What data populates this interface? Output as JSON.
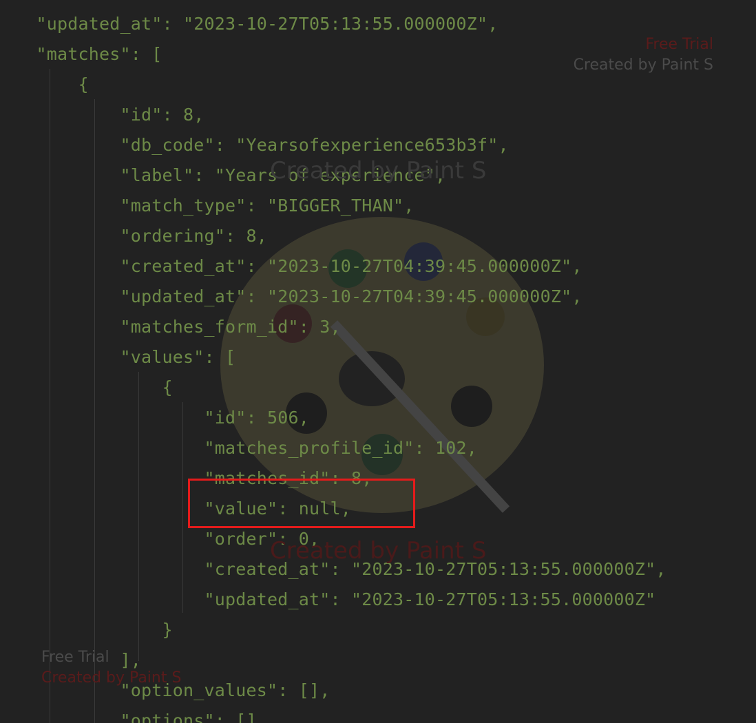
{
  "code_lines": [
    {
      "text": "  \"updated_at\": \"2023-10-27T05:13:55.000000Z\",",
      "indent": 0
    },
    {
      "text": "  \"matches\": [",
      "indent": 0
    },
    {
      "text": "      {",
      "indent": 0
    },
    {
      "text": "          \"id\": 8,",
      "indent": 0
    },
    {
      "text": "          \"db_code\": \"Yearsofexperience653b3f\",",
      "indent": 0
    },
    {
      "text": "          \"label\": \"Years of experience\",",
      "indent": 0
    },
    {
      "text": "          \"match_type\": \"BIGGER_THAN\",",
      "indent": 0
    },
    {
      "text": "          \"ordering\": 8,",
      "indent": 0
    },
    {
      "text": "          \"created_at\": \"2023-10-27T04:39:45.000000Z\",",
      "indent": 0
    },
    {
      "text": "          \"updated_at\": \"2023-10-27T04:39:45.000000Z\",",
      "indent": 0
    },
    {
      "text": "          \"matches_form_id\": 3,",
      "indent": 0
    },
    {
      "text": "          \"values\": [",
      "indent": 0
    },
    {
      "text": "              {",
      "indent": 0
    },
    {
      "text": "                  \"id\": 506,",
      "indent": 0
    },
    {
      "text": "                  \"matches_profile_id\": 102,",
      "indent": 0
    },
    {
      "text": "                  \"matches_id\": 8,",
      "indent": 0
    },
    {
      "text": "                  \"value\": null,",
      "indent": 0
    },
    {
      "text": "                  \"order\": 0,",
      "indent": 0
    },
    {
      "text": "                  \"created_at\": \"2023-10-27T05:13:55.000000Z\",",
      "indent": 0
    },
    {
      "text": "                  \"updated_at\": \"2023-10-27T05:13:55.000000Z\"",
      "indent": 0
    },
    {
      "text": "              }",
      "indent": 0
    },
    {
      "text": "          ],",
      "indent": 0
    },
    {
      "text": "          \"option_values\": [],",
      "indent": 0
    },
    {
      "text": "          \"options\": []",
      "indent": 0
    }
  ],
  "watermarks": {
    "top_right_line1": "Free Trial",
    "top_right_line2": "Created by Paint S",
    "center_top": "Created by Paint S",
    "center_bottom": "Created by Paint S",
    "bottom_left_line1": "Free Trial",
    "bottom_left_line2": "Created by Paint S"
  },
  "colors": {
    "background": "#222222",
    "code_text": "#6d8a47",
    "highlight_box": "#e41b1b"
  },
  "highlight": {
    "target_line": "\"value\": null,"
  }
}
